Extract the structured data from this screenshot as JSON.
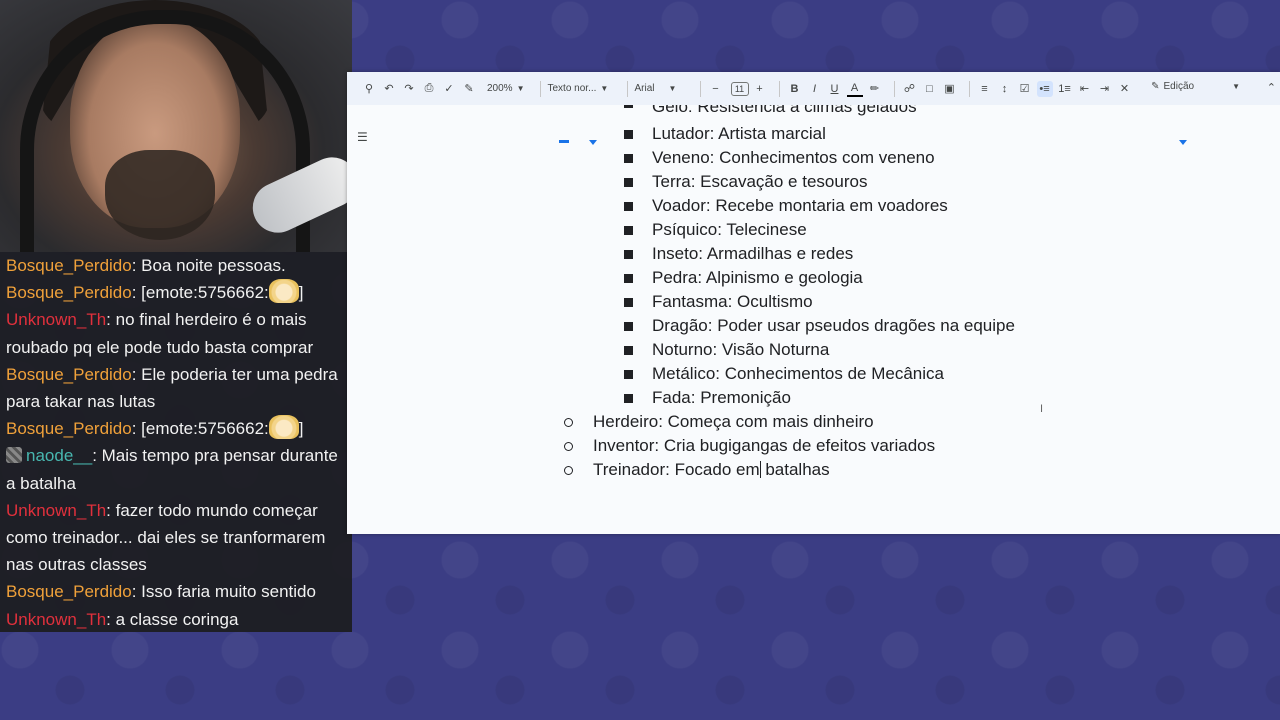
{
  "toolbar": {
    "zoom": "200%",
    "style": "Texto nor...",
    "font": "Arial",
    "font_size": "11",
    "mode": "Edição"
  },
  "document": {
    "cut_off_line": "Gelo: Resistência a climas gelados",
    "type_items": [
      "Lutador: Artista marcial",
      "Veneno: Conhecimentos com veneno",
      "Terra: Escavação e tesouros",
      "Voador: Recebe montaria em voadores",
      "Psíquico: Telecinese",
      "Inseto: Armadilhas e redes",
      "Pedra: Alpinismo e geologia",
      "Fantasma: Ocultismo",
      "Dragão: Poder usar pseudos dragões na equipe",
      "Noturno: Visão Noturna",
      "Metálico: Conhecimentos de Mecânica",
      "Fada: Premonição"
    ],
    "class_items": [
      "Herdeiro: Começa com mais dinheiro",
      "Inventor: Cria bugigangas de efeitos variados"
    ],
    "last_item_before_cursor": "Treinador: Focado em",
    "last_item_after_cursor": " batalhas"
  },
  "chat": {
    "messages": [
      {
        "user": "Bosque_Perdido",
        "text": ": Boa noite pessoas."
      },
      {
        "user": "Bosque_Perdido",
        "text": ": [emote:5756662:",
        "emote": true,
        "text_after": "]"
      },
      {
        "user": "Unknown_Th",
        "text": ": no final herdeiro é o mais roubado pq ele pode tudo basta comprar"
      },
      {
        "user": "Bosque_Perdido",
        "text": ": Ele poderia ter uma pedra para takar nas lutas"
      },
      {
        "user": "Bosque_Perdido",
        "text": ": [emote:5756662:",
        "emote": true,
        "text_after": "]"
      },
      {
        "user": "naode__",
        "text": ": Mais tempo pra pensar durante a batalha"
      },
      {
        "user": "Unknown_Th",
        "text": ": fazer todo mundo começar como treinador... dai eles se tranformarem nas outras classes"
      },
      {
        "user": "Bosque_Perdido",
        "text": ": Isso faria muito sentido"
      },
      {
        "user": "Unknown_Th",
        "text": ": a classe coringa"
      }
    ]
  },
  "colors": {
    "background": "#3b3d84",
    "chat_bg": "#1c1c1e",
    "user_orange": "#f0a13a",
    "user_red": "#e0303c",
    "user_teal": "#48b7b0"
  }
}
